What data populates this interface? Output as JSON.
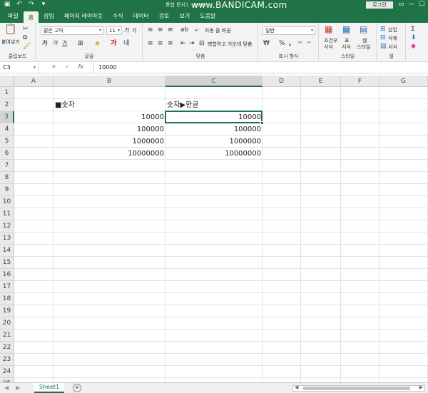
{
  "titlebar": {
    "qat_icons": [
      "save-icon",
      "undo-icon",
      "redo-icon",
      "customize-icon"
    ],
    "qat_glyphs": [
      "▣",
      "↶",
      "↷",
      "▾"
    ],
    "doc_title": "통합 문서1 - Excel",
    "watermark": "www.BANDICAM.com",
    "login": "로그인",
    "window_controls": [
      "▭",
      "—",
      "☐"
    ]
  },
  "ribbon_tabs": [
    "파일",
    "홈",
    "삽입",
    "페이지 레이아웃",
    "수식",
    "데이터",
    "검토",
    "보기",
    "도움말"
  ],
  "active_tab": "홈",
  "ribbon": {
    "clipboard": {
      "paste": "붙여넣기",
      "label": "클립보드"
    },
    "font": {
      "name": "맑은 고딕",
      "size": "11",
      "bold": "가",
      "italic": "가",
      "underline": "가",
      "label": "글꼴"
    },
    "alignment": {
      "wrap": "자동 줄 바꿈",
      "merge": "병합하고 가운데 맞춤",
      "label": "맞춤"
    },
    "number": {
      "format": "일반",
      "percent": "%",
      "comma": ",",
      "label": "표시 형식"
    },
    "styles": {
      "conditional": [
        "조건부",
        "서식"
      ],
      "table": [
        "표",
        "서식"
      ],
      "cell": [
        "셀",
        "스타일"
      ],
      "label": "스타일"
    },
    "cells": {
      "insert": "삽입",
      "delete": "삭제",
      "format": "서식",
      "label": "셀"
    }
  },
  "formula_bar": {
    "namebox": "C3",
    "fx": "fx",
    "content": "10000"
  },
  "columns": [
    "A",
    "B",
    "C",
    "D",
    "E",
    "F",
    "G"
  ],
  "selected_column": "C",
  "rows": [
    "1",
    "2",
    "3",
    "4",
    "5",
    "6",
    "7",
    "8",
    "9",
    "10",
    "11",
    "12",
    "13",
    "14",
    "15",
    "16",
    "17",
    "18",
    "19",
    "20",
    "21",
    "22",
    "23",
    "24",
    "25"
  ],
  "selected_row": "3",
  "cells": {
    "B2": "■숫자",
    "C2": "숫자▶한글",
    "B3": "10000",
    "C3": "10000",
    "B4": "100000",
    "C4": "100000",
    "B5": "1000000",
    "C5": "1000000",
    "B6": "10000000",
    "C6": "10000000"
  },
  "sheet_tabs": [
    "Sheet1"
  ],
  "add_sheet": "+",
  "accent_color": "#1f7346"
}
